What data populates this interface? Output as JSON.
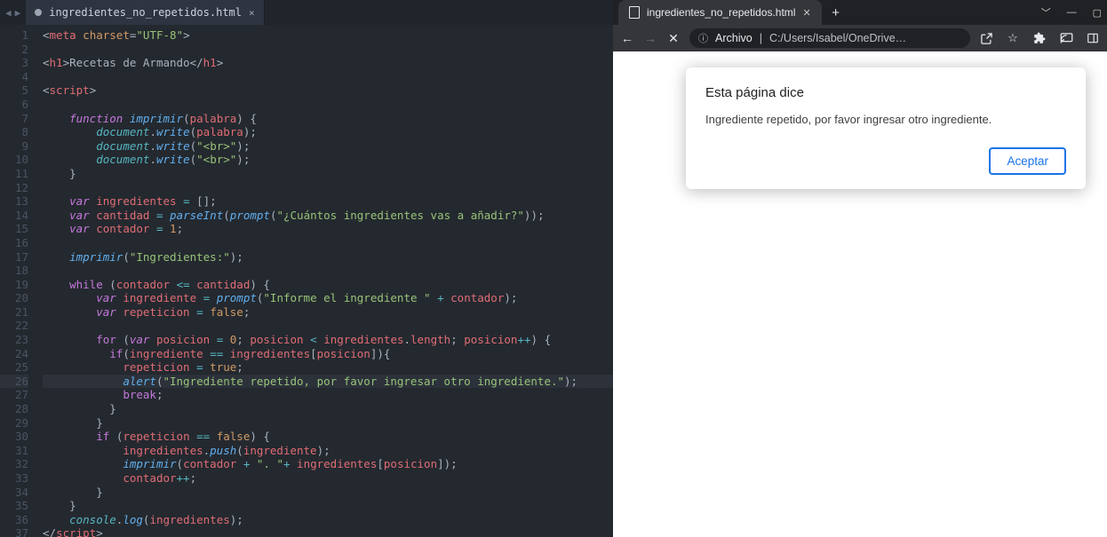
{
  "editor": {
    "tab_title": "ingredientes_no_repetidos.html",
    "close_glyph": "×",
    "lines": [
      "<span class='pn'>&lt;</span><span class='tg'>meta</span> <span class='at'>charset</span><span class='pn'>=</span><span class='st'>\"UTF-8\"</span><span class='pn'>&gt;</span>",
      "",
      "<span class='pn'>&lt;</span><span class='tg'>h1</span><span class='pn'>&gt;</span>Recetas de Armando<span class='pn'>&lt;/</span><span class='tg'>h1</span><span class='pn'>&gt;</span>",
      "",
      "<span class='pn'>&lt;</span><span class='tg'>script</span><span class='pn'>&gt;</span>",
      "",
      "    <span class='kw'>function</span> <span class='fn'>imprimir</span><span class='pn'>(</span><span class='vr'>palabra</span><span class='pn'>) {</span>",
      "        <span class='ob'>document</span><span class='pn'>.</span><span class='fn'>write</span><span class='pn'>(</span><span class='vr'>palabra</span><span class='pn'>);</span>",
      "        <span class='ob'>document</span><span class='pn'>.</span><span class='fn'>write</span><span class='pn'>(</span><span class='st'>\"&lt;br&gt;\"</span><span class='pn'>);</span>",
      "        <span class='ob'>document</span><span class='pn'>.</span><span class='fn'>write</span><span class='pn'>(</span><span class='st'>\"&lt;br&gt;\"</span><span class='pn'>);</span>",
      "    <span class='pn'>}</span>",
      "",
      "    <span class='kw'>var</span> <span class='vr'>ingredientes</span> <span class='op'>=</span> <span class='pn'>[];</span>",
      "    <span class='kw'>var</span> <span class='vr'>cantidad</span> <span class='op'>=</span> <span class='fn'>parseInt</span><span class='pn'>(</span><span class='fn'>prompt</span><span class='pn'>(</span><span class='st'>\"¿Cuántos ingredientes vas a añadir?\"</span><span class='pn'>));</span>",
      "    <span class='kw'>var</span> <span class='vr'>contador</span> <span class='op'>=</span> <span class='nm'>1</span><span class='pn'>;</span>",
      "",
      "    <span class='fn'>imprimir</span><span class='pn'>(</span><span class='st'>\"Ingredientes:\"</span><span class='pn'>);</span>",
      "",
      "    <span class='kw2'>while</span> <span class='pn'>(</span><span class='vr'>contador</span> <span class='op'>&lt;=</span> <span class='vr'>cantidad</span><span class='pn'>) {</span>",
      "        <span class='kw'>var</span> <span class='vr'>ingrediente</span> <span class='op'>=</span> <span class='fn'>prompt</span><span class='pn'>(</span><span class='st'>\"Informe el ingrediente \"</span> <span class='op'>+</span> <span class='vr'>contador</span><span class='pn'>);</span>",
      "        <span class='kw'>var</span> <span class='vr'>repeticion</span> <span class='op'>=</span> <span class='nm'>false</span><span class='pn'>;</span>",
      "",
      "        <span class='kw2'>for</span> <span class='pn'>(</span><span class='kw'>var</span> <span class='vr'>posicion</span> <span class='op'>=</span> <span class='nm'>0</span><span class='pn'>;</span> <span class='vr'>posicion</span> <span class='op'>&lt;</span> <span class='vr'>ingredientes</span><span class='pn'>.</span><span class='vr'>length</span><span class='pn'>;</span> <span class='vr'>posicion</span><span class='op'>++</span><span class='pn'>) {</span>",
      "          <span class='kw2'>if</span><span class='pn'>(</span><span class='vr'>ingrediente</span> <span class='op'>==</span> <span class='vr'>ingredientes</span><span class='pn'>[</span><span class='vr'>posicion</span><span class='pn'>]){</span>",
      "            <span class='vr'>repeticion</span> <span class='op'>=</span> <span class='nm'>true</span><span class='pn'>;</span>",
      "            <span class='fn'>alert</span><span class='pn'>(</span><span class='st'>\"Ingrediente repetido, por favor ingresar otro ingrediente.\"</span><span class='pn'>);</span>",
      "            <span class='kw2'>break</span><span class='pn'>;</span>",
      "          <span class='pn'>}</span>",
      "        <span class='pn'>}</span>",
      "        <span class='kw2'>if</span> <span class='pn'>(</span><span class='vr'>repeticion</span> <span class='op'>==</span> <span class='nm'>false</span><span class='pn'>) {</span>",
      "            <span class='vr'>ingredientes</span><span class='pn'>.</span><span class='fn'>push</span><span class='pn'>(</span><span class='vr'>ingrediente</span><span class='pn'>);</span>",
      "            <span class='fn'>imprimir</span><span class='pn'>(</span><span class='vr'>contador</span> <span class='op'>+</span> <span class='st'>\". \"</span><span class='op'>+</span> <span class='vr'>ingredientes</span><span class='pn'>[</span><span class='vr'>posicion</span><span class='pn'>]);</span>",
      "            <span class='vr'>contador</span><span class='op'>++</span><span class='pn'>;</span>",
      "        <span class='pn'>}</span>",
      "    <span class='pn'>}</span>",
      "    <span class='ob'>console</span><span class='pn'>.</span><span class='fn'>log</span><span class='pn'>(</span><span class='vr'>ingredientes</span><span class='pn'>);</span>",
      "<span class='pn'>&lt;/</span><span class='tg'>script</span><span class='pn'>&gt;</span>"
    ],
    "current_line_index": 25
  },
  "browser": {
    "tab_title": "ingredientes_no_repetidos.html",
    "newtab_glyph": "+",
    "addr_scheme": "Archivo",
    "addr_url": "C:/Users/Isabel/OneDrive…",
    "dialog_title": "Esta página dice",
    "dialog_message": "Ingrediente repetido, por favor ingresar otro ingrediente.",
    "dialog_ok": "Aceptar"
  }
}
